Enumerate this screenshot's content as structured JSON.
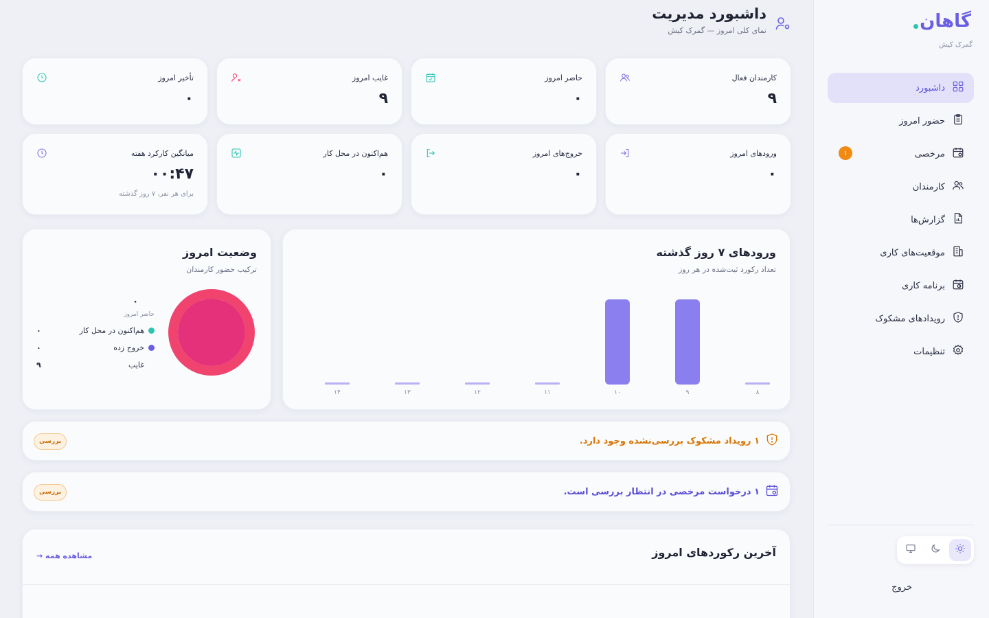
{
  "brand": {
    "name": "گاهان",
    "subtitle": "گمرک کیش"
  },
  "sidebar": {
    "items": [
      {
        "label": "داشبورد",
        "icon": "dashboard-grid-icon",
        "active": true
      },
      {
        "label": "حضور امروز",
        "icon": "clipboard-icon"
      },
      {
        "label": "مرخصی",
        "icon": "calendar-leave-icon",
        "badge": "۱"
      },
      {
        "label": "کارمندان",
        "icon": "users-icon"
      },
      {
        "label": "گزارش‌ها",
        "icon": "report-file-icon"
      },
      {
        "label": "موقعیت‌های کاری",
        "icon": "building-icon"
      },
      {
        "label": "برنامه کاری",
        "icon": "calendar-clock-icon"
      },
      {
        "label": "رویدادهای مشکوک",
        "icon": "shield-alert-icon"
      },
      {
        "label": "تنظیمات",
        "icon": "gear-icon"
      }
    ],
    "logout_label": "خروج",
    "theme_options": [
      "light",
      "dark",
      "system"
    ]
  },
  "header": {
    "title": "داشبورد مدیریت",
    "subtitle": "نمای کلی امروز — گمرک کیش"
  },
  "stats": {
    "active_employees": {
      "label": "کارمندان فعال",
      "value": "۹",
      "icon": "users-icon",
      "color": "#7b70e6"
    },
    "present_today": {
      "label": "حاضر امروز",
      "value": "۰",
      "icon": "calendar-check-icon",
      "color": "#2bc4b0"
    },
    "absent_today": {
      "label": "غایب امروز",
      "value": "۹",
      "icon": "user-x-icon",
      "color": "#f0436e"
    },
    "late_today": {
      "label": "تأخیر امروز",
      "value": "۰",
      "icon": "clock-icon",
      "color": "#2bc4b0"
    },
    "entries_today": {
      "label": "ورودهای امروز",
      "value": "۰",
      "icon": "login-icon",
      "color": "#7b70e6"
    },
    "exits_today": {
      "label": "خروج‌های امروز",
      "value": "۰",
      "icon": "logout-icon",
      "color": "#2bc4b0"
    },
    "on_site_now": {
      "label": "هم‌اکنون در محل کار",
      "value": "۰",
      "icon": "activity-icon",
      "color": "#2bc4b0"
    },
    "weekly_avg": {
      "label": "میانگین کارکرد هفته",
      "value": "۰۰:۴۷",
      "note": "برای هر نفر، ۷ روز گذشته",
      "icon": "clock-icon",
      "color": "#7b70e6"
    }
  },
  "entries_chart": {
    "title": "ورودهای ۷ روز گذشته",
    "subtitle": "تعداد رکورد ثبت‌شده در هر روز"
  },
  "chart_data": {
    "type": "bar",
    "categories": [
      "۱۴",
      "۱۳",
      "۱۲",
      "۱۱",
      "۱۰",
      "۹",
      "۸"
    ],
    "values": [
      0,
      0,
      0,
      0,
      1,
      1,
      0
    ],
    "ylim": [
      0,
      1
    ],
    "grid": false,
    "color": "#8b7ff0"
  },
  "today_status": {
    "title": "وضعیت امروز",
    "subtitle": "ترکیب حضور کارمندان",
    "center_value": "۰",
    "center_label": "حاضر امروز",
    "legend": [
      {
        "name": "هم‌اکنون در محل کار",
        "value": "۰",
        "color": "#2bc4b0"
      },
      {
        "name": "خروج زده",
        "value": "۰",
        "color": "#6a5fe3"
      },
      {
        "name": "غایب",
        "value": "۹",
        "color": "#f0436e"
      }
    ]
  },
  "alerts": [
    {
      "text": "۱ رویداد مشکوک بررسی‌نشده وجود دارد.",
      "button": "بررسی",
      "icon": "shield-alert-icon",
      "color": "#d97706"
    },
    {
      "text": "۱ درخواست مرخصی در انتظار بررسی است.",
      "button": "بررسی",
      "icon": "calendar-leave-icon",
      "color": "#5a4fd6"
    }
  ],
  "records": {
    "title": "آخرین رکوردهای امروز",
    "view_all": "مشاهده همه →"
  }
}
